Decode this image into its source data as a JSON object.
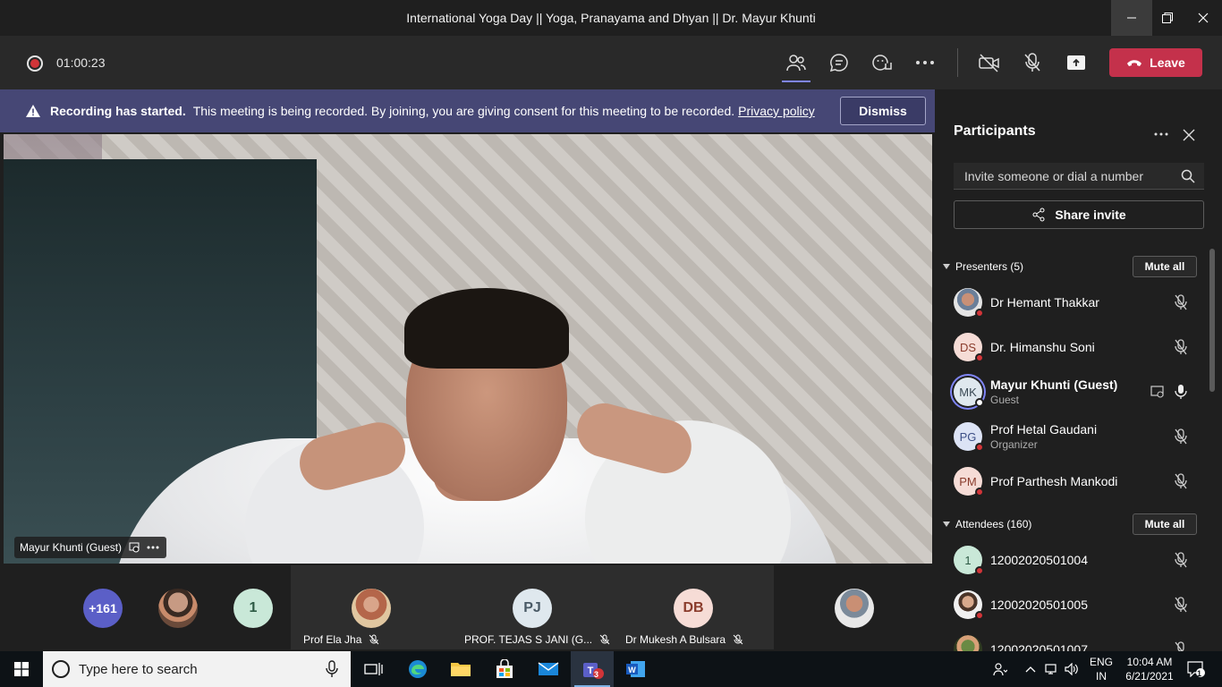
{
  "window": {
    "title": "International Yoga Day || Yoga, Pranayama and Dhyan || Dr. Mayur Khunti"
  },
  "toolbar": {
    "recording_time": "01:00:23",
    "leave_label": "Leave"
  },
  "banner": {
    "strong_text": "Recording has started.",
    "text": "This meeting is being recorded. By joining, you are giving consent for this meeting to be recorded.",
    "link_text": "Privacy policy",
    "dismiss_label": "Dismiss"
  },
  "video": {
    "speaker_label": "Mayur Khunti (Guest)"
  },
  "strip": {
    "overflow_count": "+161",
    "tiles": [
      {
        "initials": "1"
      },
      {
        "name": "Prof Ela Jha"
      },
      {
        "initials": "PJ",
        "name": "PROF. TEJAS S JANI (G..."
      },
      {
        "initials": "DB",
        "name": "Dr Mukesh A Bulsara"
      }
    ]
  },
  "panel": {
    "title": "Participants",
    "invite_placeholder": "Invite someone or dial a number",
    "share_invite_label": "Share invite",
    "presenters_header": "Presenters (5)",
    "attendees_header": "Attendees (160)",
    "mute_all_label": "Mute all",
    "presenters": [
      {
        "name": "Dr Hemant Thakkar",
        "initials": ""
      },
      {
        "name": "Dr. Himanshu Soni",
        "initials": "DS"
      },
      {
        "name": "Mayur Khunti (Guest)",
        "initials": "MK",
        "role": "Guest"
      },
      {
        "name": "Prof Hetal Gaudani",
        "initials": "PG",
        "role": "Organizer"
      },
      {
        "name": "Prof Parthesh Mankodi",
        "initials": "PM"
      }
    ],
    "attendees": [
      {
        "name": "12002020501004",
        "initials": "1"
      },
      {
        "name": "12002020501005",
        "initials": ""
      },
      {
        "name": "12002020501007",
        "initials": ""
      }
    ]
  },
  "taskbar": {
    "search_placeholder": "Type here to search",
    "teams_badge": "3",
    "lang_line1": "ENG",
    "lang_line2": "IN",
    "time": "10:04 AM",
    "date": "6/21/2021",
    "notification_count": "1"
  },
  "colors": {
    "accent": "#7f85f5",
    "leave": "#c4314b",
    "banner": "#464775",
    "status_red": "#d13438"
  }
}
